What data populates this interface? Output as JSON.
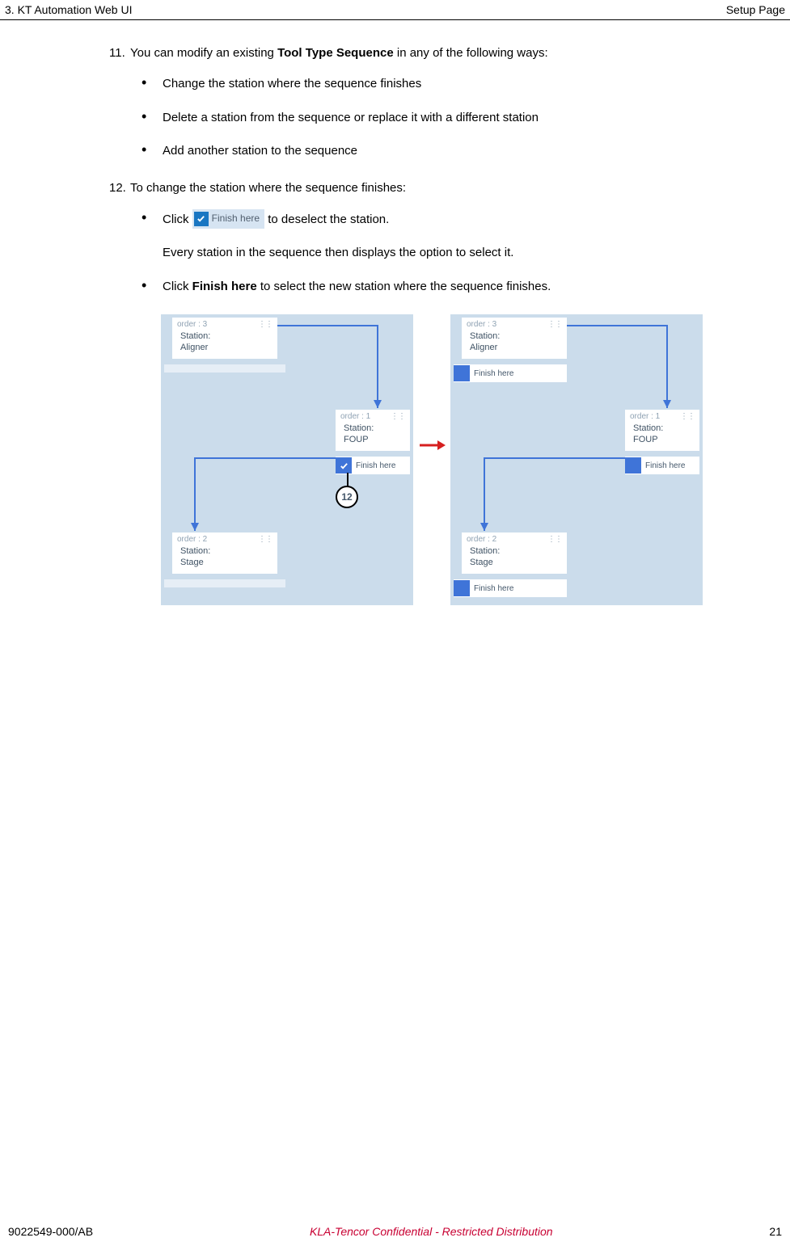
{
  "header": {
    "left": "3. KT Automation Web UI",
    "right": "Setup Page"
  },
  "step11": {
    "num": "11.",
    "pre": "You can modify an existing ",
    "bold": "Tool Type Sequence",
    "post": " in any of the following ways:",
    "bullets": [
      "Change the station where the sequence finishes",
      "Delete a station from the sequence or replace it with a different station",
      "Add another station to the sequence"
    ]
  },
  "step12": {
    "num": "12.",
    "intro": "To change the station where the sequence finishes:",
    "b1_pre": "Click ",
    "b1_btn": "Finish here",
    "b1_post": " to deselect the station.",
    "b1_extra": "Every station in the sequence then displays the option to select it.",
    "b2_pre": "Click ",
    "b2_bold": "Finish here",
    "b2_post": " to select the new station where the sequence finishes."
  },
  "diagram": {
    "order3": "order : 3",
    "order1": "order : 1",
    "order2": "order : 2",
    "stationLabel": "Station:",
    "aligner": "Aligner",
    "foup": "FOUP",
    "stage": "Stage",
    "finishHere": "Finish here",
    "callout": "12"
  },
  "footer": {
    "doc": "9022549-000/AB",
    "conf": "KLA-Tencor Confidential - Restricted Distribution",
    "page": "21"
  }
}
